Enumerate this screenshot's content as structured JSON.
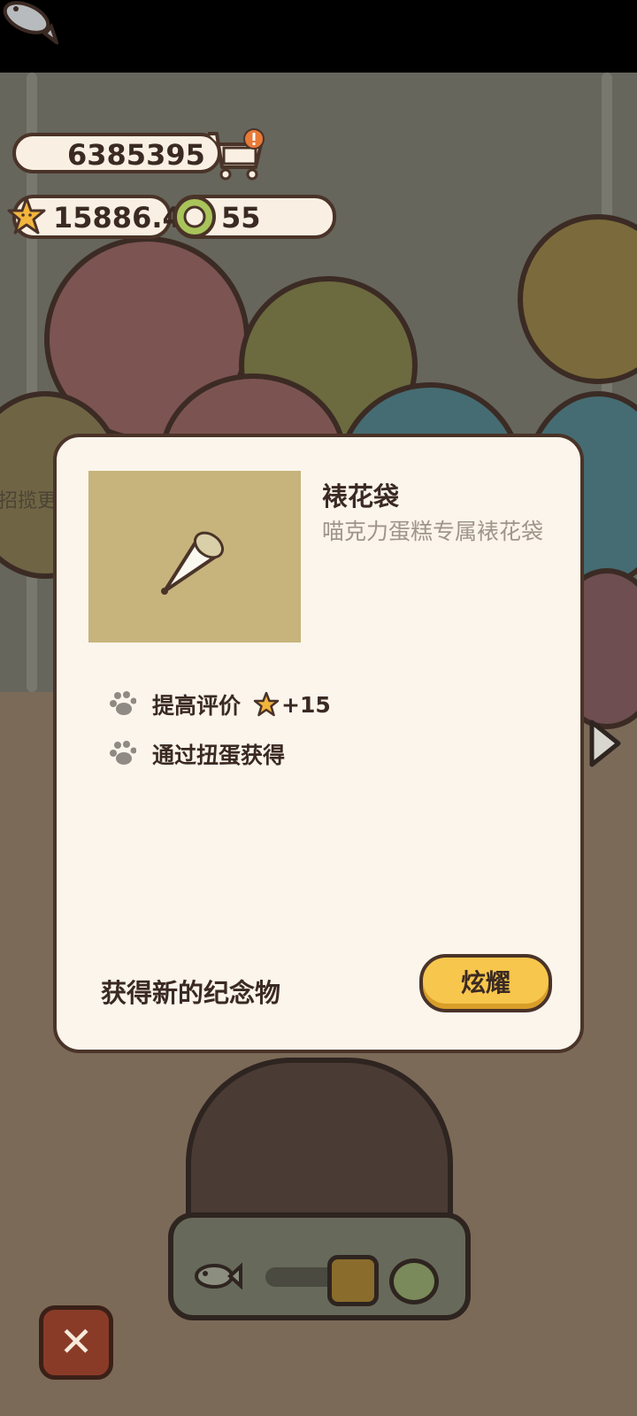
{
  "currency": {
    "fish": "6385395",
    "stars": "15886.4",
    "tokens": "55"
  },
  "background": {
    "side_text": "招揽更"
  },
  "dialog": {
    "item_name": "裱花袋",
    "item_description": "喵克力蛋糕专属裱花袋",
    "attributes": [
      {
        "label": "提高评价",
        "bonus": "+15"
      },
      {
        "label": "通过扭蛋获得"
      }
    ],
    "footer_text": "获得新的纪念物",
    "show_button": "炫耀"
  },
  "icons": {
    "fish": "fish-icon",
    "cart": "shop-cart-icon",
    "star": "star-icon",
    "token": "green-token-icon",
    "paw": "paw-icon",
    "close": "close-icon",
    "arrow": "arrow-right-icon"
  },
  "colors": {
    "accent_button": "#f7c64c",
    "dialog_bg": "#fbf5ec",
    "close_button": "#8a3b28"
  }
}
